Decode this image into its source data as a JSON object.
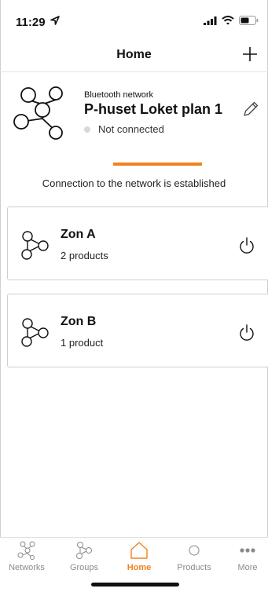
{
  "status_bar": {
    "time": "11:29"
  },
  "nav": {
    "title": "Home",
    "add_icon": "plus-icon"
  },
  "network": {
    "type_label": "Bluetooth network",
    "name": "P-huset Loket plan 1",
    "status": "Not connected",
    "status_color": "#d9d9d9",
    "icon": "network-graph-icon",
    "edit_icon": "pencil-icon"
  },
  "connection": {
    "message": "Connection to the network is established",
    "progress_color": "#f0821e"
  },
  "zones": [
    {
      "name": "Zon A",
      "count": "2 products",
      "icon": "group-icon",
      "action_icon": "power-icon"
    },
    {
      "name": "Zon B",
      "count": "1 product",
      "icon": "group-icon",
      "action_icon": "power-icon"
    }
  ],
  "tabs": [
    {
      "label": "Networks",
      "icon": "networks-icon",
      "active": false
    },
    {
      "label": "Groups",
      "icon": "groups-icon",
      "active": false
    },
    {
      "label": "Home",
      "icon": "home-icon",
      "active": true
    },
    {
      "label": "Products",
      "icon": "products-icon",
      "active": false
    },
    {
      "label": "More",
      "icon": "more-icon",
      "active": false
    }
  ],
  "colors": {
    "accent": "#f0821e",
    "inactive": "#8a8a8a"
  }
}
